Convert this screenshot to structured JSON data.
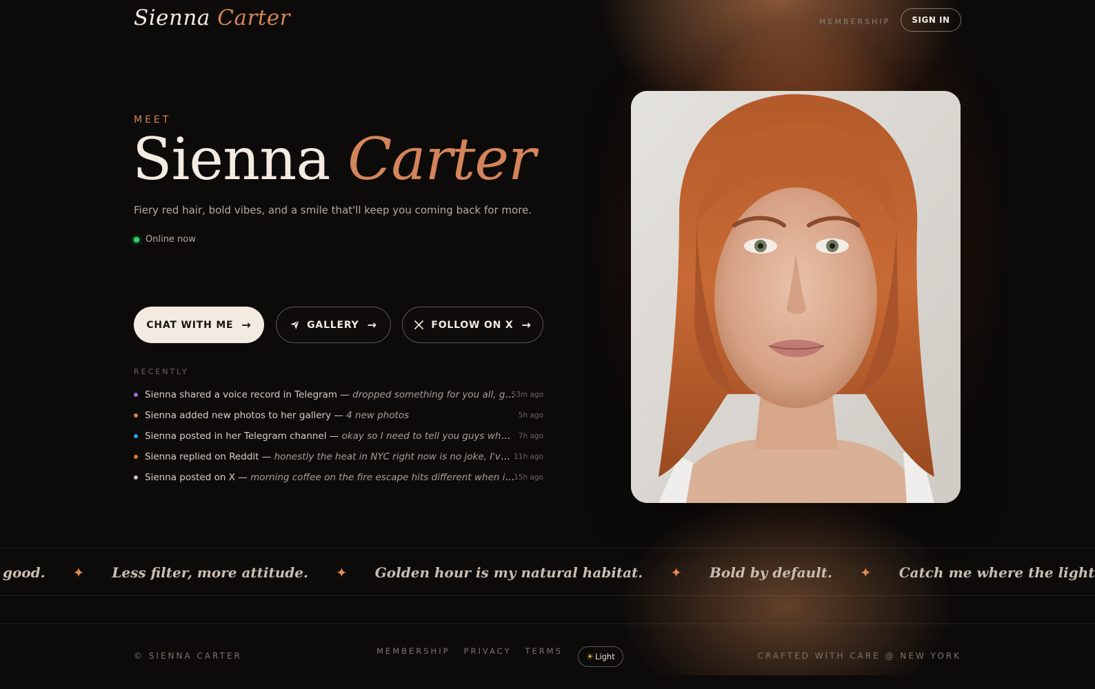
{
  "header": {
    "logo_first": "Sienna",
    "logo_last": "Carter",
    "nav_membership": "MEMBERSHIP",
    "signin_label": "SIGN IN"
  },
  "hero": {
    "eyebrow": "MEET",
    "name_first": "Sienna",
    "name_last": "Carter",
    "tagline": "Fiery red hair, bold vibes, and a smile that'll keep you coming back for more.",
    "status": "Online now",
    "status_color": "#2fd26a"
  },
  "actions": {
    "chat_label": "CHAT WITH ME",
    "gallery_label": "GALLERY",
    "follow_label": "FOLLOW ON X",
    "arrow": "→"
  },
  "recent": {
    "title": "RECENTLY",
    "items": [
      {
        "text": "Sienna shared a voice record in Telegram — ",
        "detail": "dropped something for you all, go che...",
        "time": "53m ago",
        "color": "#9b6fd6"
      },
      {
        "text": "Sienna added new photos to her gallery — ",
        "detail": "4 new photos",
        "time": "5h ago",
        "color": "#d4845a"
      },
      {
        "text": "Sienna posted in her Telegram channel — ",
        "detail": "okay so I need to tell you guys what happ...",
        "time": "7h ago",
        "color": "#3a9bd9"
      },
      {
        "text": "Sienna replied on Reddit — ",
        "detail": "honestly the heat in NYC right now is no joke, I've been ...",
        "time": "11h ago",
        "color": "#e0773a"
      },
      {
        "text": "Sienna posted on X — ",
        "detail": "morning coffee on the fire escape hits different when it's fina...",
        "time": "15h ago",
        "color": "#cfc7bf"
      }
    ]
  },
  "marquee": {
    "phrases": [
      "he light is good.",
      "Less filter, more attitude.",
      "Golden hour is my natural habitat.",
      "Bold by default.",
      "Catch me where the light is good."
    ],
    "star": "✦"
  },
  "footer": {
    "copyright": "© SIENNA CARTER",
    "links": [
      "MEMBERSHIP",
      "PRIVACY",
      "TERMS"
    ],
    "theme_label": "Light",
    "theme_icon": "☀",
    "crafted": "CRAFTED WITH CARE @ NEW YORK"
  },
  "colors": {
    "accent": "#d4845a",
    "background": "#0d0b0a",
    "cream": "#f3ebe2"
  }
}
